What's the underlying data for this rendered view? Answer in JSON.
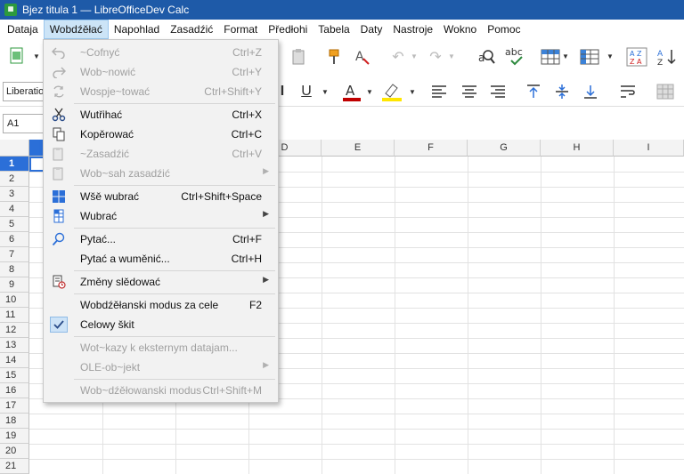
{
  "window": {
    "title": "Bjez titula 1 — LibreOfficeDev Calc",
    "app_icon": "calc-icon"
  },
  "menubar": [
    "Dataja",
    "Wobdźěłać",
    "Napohlad",
    "Zasadźić",
    "Format",
    "Předłohi",
    "Tabela",
    "Daty",
    "Nastroje",
    "Wokno",
    "Pomoc"
  ],
  "toolbar": {
    "font_name": "Liberatio",
    "name_box": "A1"
  },
  "columns": [
    "D",
    "E",
    "F",
    "G",
    "H",
    "I"
  ],
  "rows": [
    "1",
    "2",
    "3",
    "4",
    "5",
    "6",
    "7",
    "8",
    "9",
    "10",
    "11",
    "12",
    "13",
    "14",
    "15",
    "16",
    "17",
    "18",
    "19",
    "20",
    "21"
  ],
  "edit_menu": {
    "undo": {
      "label": "~Cofnyć",
      "shortcut": "Ctrl+Z"
    },
    "redo": {
      "label": "Wob~nowić",
      "shortcut": "Ctrl+Y"
    },
    "repeat": {
      "label": "Wospje~tować",
      "shortcut": "Ctrl+Shift+Y"
    },
    "cut": {
      "label": "Wutřihać",
      "shortcut": "Ctrl+X"
    },
    "copy": {
      "label": "Kopěrować",
      "shortcut": "Ctrl+C"
    },
    "paste": {
      "label": "~Zasadźić",
      "shortcut": "Ctrl+V"
    },
    "paste_special": {
      "label": "Wob~sah zasadźić"
    },
    "select_all": {
      "label": "Wšě wubrać",
      "shortcut": "Ctrl+Shift+Space"
    },
    "select": {
      "label": "Wubrać"
    },
    "find": {
      "label": "Pytać...",
      "shortcut": "Ctrl+F"
    },
    "find_replace": {
      "label": "Pytać a wuměnić...",
      "shortcut": "Ctrl+H"
    },
    "track_changes": {
      "label": "Změny slědować"
    },
    "edit_mode": {
      "label": "Wobdźěłanski modus za cele",
      "shortcut": "F2"
    },
    "whole_sheet": {
      "label": "Celowy škit"
    },
    "links": {
      "label": "Wot~kazy k eksternym datajam..."
    },
    "ole_object": {
      "label": "OLE-ob~jekt"
    },
    "edit_mode_toggle": {
      "label": "Wob~dźěłowanski modus",
      "shortcut": "Ctrl+Shift+M"
    }
  },
  "colors": {
    "titlebar": "#1e5aa8",
    "selection": "#2b6fd8",
    "font_color": "#c00000",
    "highlight": "#ffe600"
  }
}
